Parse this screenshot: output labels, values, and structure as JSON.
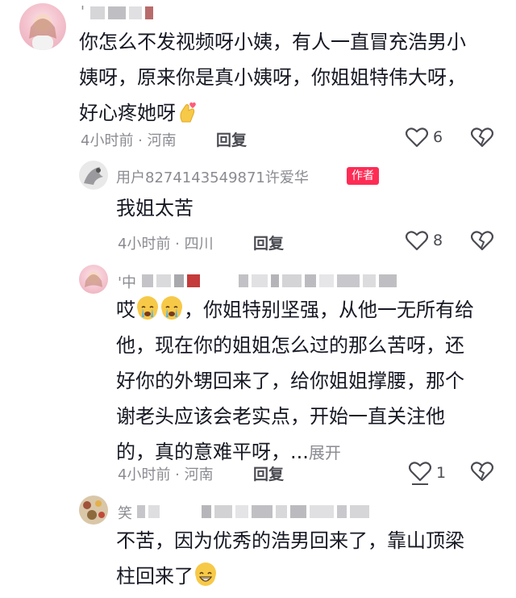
{
  "comments": [
    {
      "username": "'",
      "text_lines": [
        "你怎么不发视频呀小姨，有人一直冒充浩男小",
        "姨呀，原来你是真小姨呀，你姐姐特伟大呀，",
        "好心疼她呀"
      ],
      "meta": "4小时前 · 河南",
      "reply_label": "回复",
      "likes": "6"
    },
    {
      "username": "用户8274143549871许爱华",
      "badge": "作者",
      "text_lines": [
        "我姐太苦"
      ],
      "meta": "4小时前 · 四川",
      "reply_label": "回复",
      "likes": "8"
    },
    {
      "username": "'中",
      "text_lines": [
        "哎",
        "，你姐特别坚强，从他一无所有给",
        "他，现在你的姐姐怎么过的那么苦呀，还",
        "好你的外甥回来了，给你姐姐撑腰，那个",
        "谢老头应该会老实点，开始一直关注他",
        "的，真的意难平呀，..."
      ],
      "expand_label": "展开",
      "meta": "4小时前 · 河南",
      "reply_label": "回复",
      "likes": "1"
    },
    {
      "username": "笑",
      "text_lines": [
        "不苦，因为优秀的浩男回来了，靠山顶梁",
        "柱回来了"
      ]
    }
  ],
  "icons": [
    "heart-icon",
    "broken-heart-icon",
    "finger-heart-emoji",
    "crying-emoji",
    "grin-emoji"
  ],
  "colors": {
    "badge": "#fe2c55",
    "meta": "#8a8b91",
    "text": "#161823"
  }
}
